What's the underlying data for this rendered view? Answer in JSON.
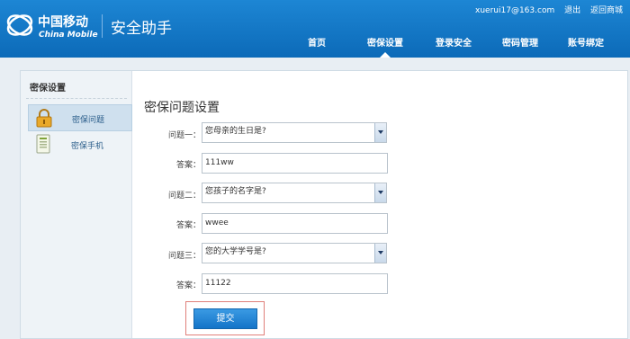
{
  "header": {
    "logo_cn": "中国移动",
    "logo_en": "China Mobile",
    "app_title": "安全助手",
    "user": "xuerui17@163.com",
    "logout": "退出",
    "back_to_mall": "返回商城",
    "nav": [
      "首页",
      "密保设置",
      "登录安全",
      "密码管理",
      "账号绑定"
    ],
    "active_nav": "密保设置"
  },
  "sidebar": {
    "title": "密保设置",
    "items": [
      {
        "label": "密保问题",
        "icon": "lock-icon",
        "active": true
      },
      {
        "label": "密保手机",
        "icon": "phone-list-icon",
        "active": false
      }
    ]
  },
  "form": {
    "title": "密保问题设置",
    "q1_label": "问题一：",
    "q1_value": "您母亲的生日是?",
    "a1_label": "答案：",
    "a1_value": "111ww",
    "q2_label": "问题二：",
    "q2_value": "您孩子的名字是?",
    "a2_label": "答案：",
    "a2_value": "wwee",
    "q3_label": "问题三：",
    "q3_value": "您的大学学号是?",
    "a3_label": "答案：",
    "a3_value": "11122",
    "submit": "提交"
  },
  "colors": {
    "header_blue": "#0c6ab8",
    "button_blue": "#1474c8",
    "highlight_red": "#e0807a"
  }
}
